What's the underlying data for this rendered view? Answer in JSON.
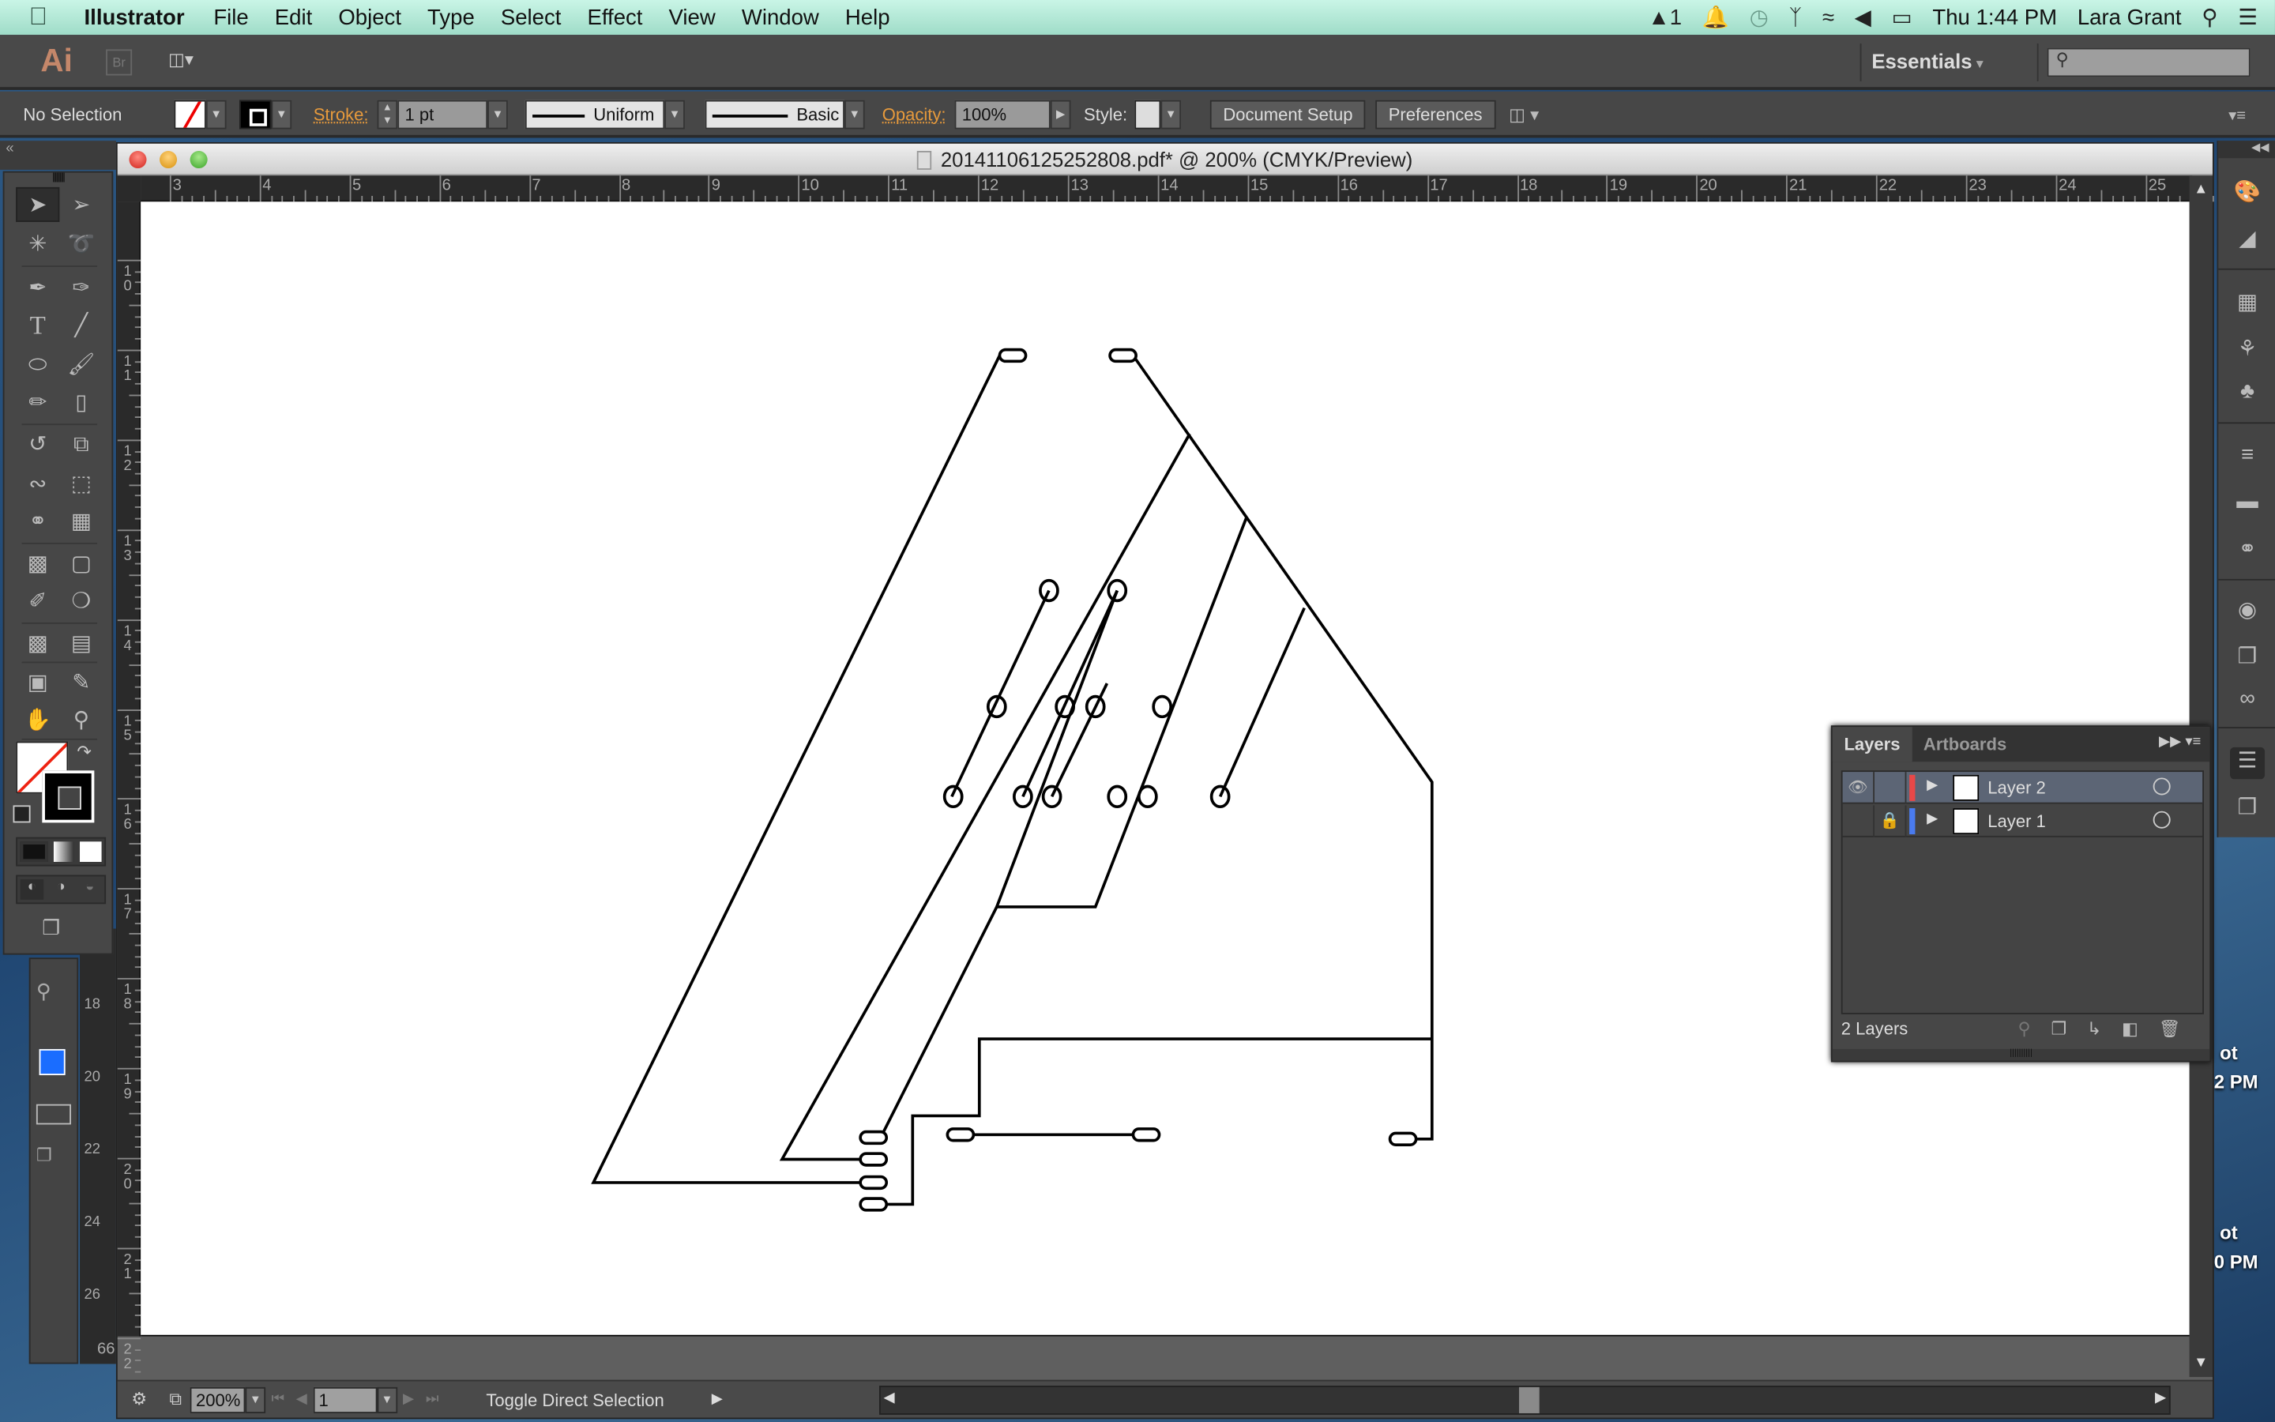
{
  "menubar": {
    "app": "Illustrator",
    "items": [
      "File",
      "Edit",
      "Object",
      "Type",
      "Select",
      "Effect",
      "View",
      "Window",
      "Help"
    ],
    "status": {
      "adobe_badge": "1",
      "clock": "Thu 1:44 PM",
      "user": "Lara Grant"
    }
  },
  "appbar": {
    "logo": "Ai",
    "bridge": "Br",
    "workspace": "Essentials",
    "search_placeholder": ""
  },
  "control": {
    "selection": "No Selection",
    "stroke_label": "Stroke:",
    "stroke_weight": "1 pt",
    "profile": "Uniform",
    "brush": "Basic",
    "opacity_label": "Opacity:",
    "opacity": "100%",
    "style_label": "Style:",
    "document_setup": "Document Setup",
    "preferences": "Preferences"
  },
  "document": {
    "title": "20141106125252808.pdf* @ 200% (CMYK/Preview)",
    "h_ruler": [
      "3",
      "4",
      "5",
      "6",
      "7",
      "8",
      "9",
      "10",
      "11",
      "12",
      "13",
      "14",
      "15",
      "16",
      "17",
      "18",
      "19",
      "20",
      "21",
      "22",
      "23",
      "24",
      "25"
    ],
    "v_ruler": [
      "10",
      "11",
      "12",
      "13",
      "14",
      "15",
      "16",
      "17",
      "18",
      "19",
      "20",
      "21",
      "22"
    ]
  },
  "statusbar": {
    "zoom": "200%",
    "artboard": "1",
    "status_text": "Toggle Direct Selection"
  },
  "layers_panel": {
    "tabs": [
      "Layers",
      "Artboards"
    ],
    "active_tab": "Layers",
    "layers": [
      {
        "name": "Layer 2",
        "visible": true,
        "locked": false,
        "color": "#e84848",
        "selected": true
      },
      {
        "name": "Layer 1",
        "visible": false,
        "locked": true,
        "color": "#4a7bef",
        "selected": false
      }
    ],
    "count": "2 Layers"
  },
  "background_app": {
    "ruler": [
      "18",
      "20",
      "22",
      "24",
      "26"
    ],
    "readout": "66",
    "fill_color": "#1a6dff"
  },
  "desktop": {
    "labels": [
      "ot",
      "2 PM",
      "ot",
      "0 PM"
    ]
  },
  "icons": {
    "tools": [
      "selection",
      "direct-selection",
      "magic-wand",
      "lasso",
      "pen",
      "curvature-pen",
      "type",
      "line-segment",
      "ellipse",
      "paintbrush",
      "pencil",
      "eraser",
      "rotate",
      "scale",
      "puppet-warp",
      "free-transform",
      "shape-builder",
      "perspective-grid",
      "mesh",
      "gradient",
      "eyedropper",
      "blend",
      "symbol-sprayer",
      "column-graph",
      "artboard",
      "slice",
      "hand",
      "zoom"
    ],
    "dock": [
      "color",
      "color-guide",
      "swatches",
      "brushes",
      "symbols",
      "stroke",
      "gradient",
      "transparency",
      "appearance",
      "graphic-styles",
      "creative-cloud-libraries",
      "layers",
      "artboards"
    ]
  }
}
